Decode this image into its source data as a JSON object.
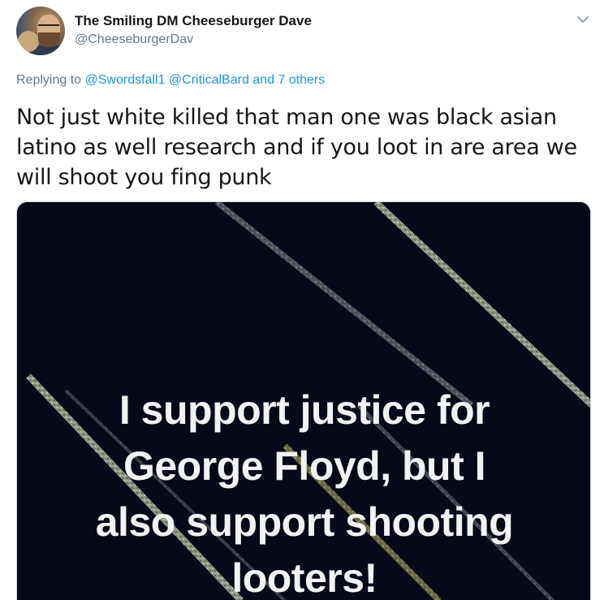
{
  "tweet": {
    "display_name": "The Smiling DM Cheeseburger Dave",
    "handle": "@CheeseburgerDav",
    "reply_prefix": "Replying to ",
    "reply_mention_1": "@Swordsfall1",
    "reply_mention_2": "@CriticalBard",
    "reply_others": "and 7 others",
    "text": "Not just white killed that man one was black asian latino as well research and if you loot in are area we will shoot you fing punk",
    "more_icon": "chevron-down-icon",
    "avatar_icon": "profile-photo"
  },
  "media": {
    "line1": "I support justice for",
    "line2": "George Floyd, but I",
    "line3": "also support shooting",
    "line4": "looters!",
    "background_color": "#07091a",
    "text_color": "#f2f2f2"
  },
  "colors": {
    "name": "#14171a",
    "secondary": "#657786",
    "link": "#1b95e0"
  }
}
